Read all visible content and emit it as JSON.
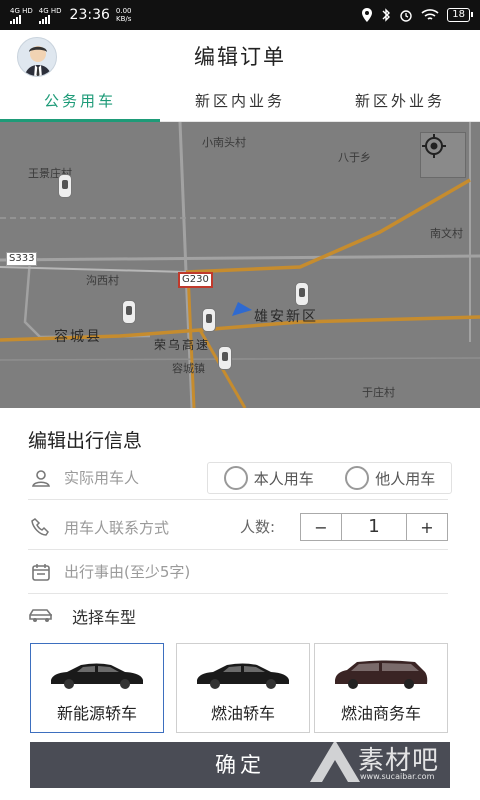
{
  "status_bar": {
    "signal1": "4G HD",
    "signal2": "4G HD",
    "time": "23:36",
    "speed_value": "0.00",
    "speed_unit": "KB/s",
    "battery": "18"
  },
  "header": {
    "title": "编辑订单"
  },
  "tabs": [
    {
      "label": "公务用车",
      "active": true
    },
    {
      "label": "新区内业务",
      "active": false
    },
    {
      "label": "新区外业务",
      "active": false
    }
  ],
  "map": {
    "labels": {
      "xiaonantou": "小南头村",
      "baxiang": "八于乡",
      "wangjing": "王景庄村",
      "nanwen": "南文村",
      "baixi": "沟西村",
      "rongcheng_county": "容城县",
      "xiongan": "雄安新区",
      "rongwu": "荣乌高速",
      "rongcheng_town": "容城镇",
      "yuzhuang": "于庄村"
    },
    "shields": {
      "s333": "S333",
      "g230": "G230"
    }
  },
  "form": {
    "section_title": "编辑出行信息",
    "passenger_placeholder": "实际用车人",
    "radio_self": "本人用车",
    "radio_other": "他人用车",
    "contact_placeholder": "用车人联系方式",
    "count_label": "人数:",
    "stepper_minus": "−",
    "stepper_value": "1",
    "stepper_plus": "+",
    "reason_placeholder": "出行事由(至少5字)",
    "car_type_label": "选择车型",
    "car_types": [
      {
        "name": "新能源轿车",
        "selected": true
      },
      {
        "name": "燃油轿车",
        "selected": false
      },
      {
        "name": "燃油商务车",
        "selected": false
      }
    ],
    "confirm_label": "确定"
  },
  "watermark": {
    "text": "素材吧",
    "url": "www.sucaibar.com"
  },
  "colors": {
    "accent": "#1e9b78",
    "confirm_bg": "#4a4c55",
    "selected_border": "#3d6fbf"
  }
}
